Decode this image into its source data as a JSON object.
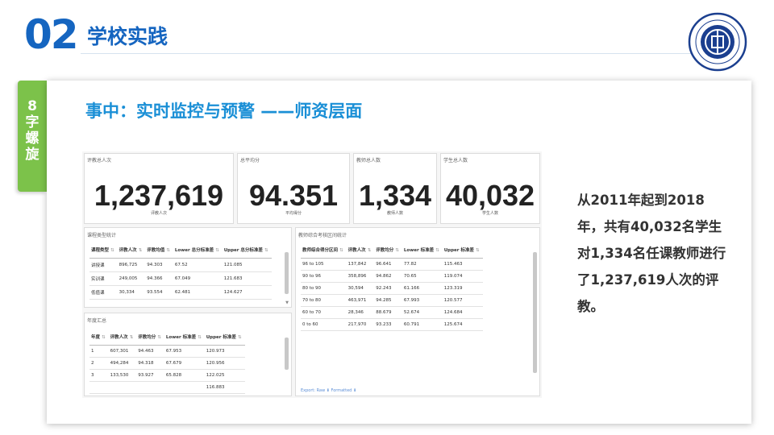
{
  "header": {
    "number": "02",
    "title": "学校实践"
  },
  "side_tag": [
    "8",
    "字",
    "螺",
    "旋"
  ],
  "card": {
    "title": "事中：实时监控与预警 ——师资层面"
  },
  "kpis": [
    {
      "label": "评教总人次",
      "value": "1,237,619",
      "sub": "评教人次"
    },
    {
      "label": "总平均分",
      "value": "94.351",
      "sub": "平均得分"
    },
    {
      "label": "教师总人数",
      "value": "1,334",
      "sub": "教师人数"
    },
    {
      "label": "学生总人数",
      "value": "40,032",
      "sub": "学生人数"
    }
  ],
  "course_table": {
    "title": "课程类型统计",
    "headers": [
      "课程类型",
      "评教人次",
      "评教均值",
      "Lower 总分标准差",
      "Upper 总分标准差"
    ],
    "rows": [
      [
        "讲授课",
        "896,725",
        "94.303",
        "67.52",
        "121.085"
      ],
      [
        "实训课",
        "249,005",
        "94.366",
        "67.049",
        "121.683"
      ],
      [
        "低值课",
        "30,334",
        "93.554",
        "62.481",
        "124.627"
      ]
    ]
  },
  "year_table": {
    "title": "年度汇总",
    "headers": [
      "年度",
      "评教人次",
      "评教均分",
      "Lower 标准差",
      "Upper 标准差"
    ],
    "rows": [
      [
        "1",
        "607,301",
        "94.463",
        "67.953",
        "120.973"
      ],
      [
        "2",
        "494,284",
        "94.318",
        "67.679",
        "120.956"
      ],
      [
        "3",
        "133,530",
        "93.927",
        "65.828",
        "122.025"
      ],
      [
        "",
        "",
        "",
        "",
        "116.883"
      ]
    ]
  },
  "score_table": {
    "title": "教师综合考核区间统计",
    "headers": [
      "教师综合得分区间",
      "评教人次",
      "评教均分",
      "Lower 标准差",
      "Upper 标准差"
    ],
    "rows": [
      [
        "96 to 105",
        "137,842",
        "96.641",
        "77.82",
        "115.463"
      ],
      [
        "90 to 96",
        "358,896",
        "94.862",
        "70.65",
        "119.074"
      ],
      [
        "80 to 90",
        "30,594",
        "92.243",
        "61.166",
        "123.319"
      ],
      [
        "70 to 80",
        "463,971",
        "94.285",
        "67.993",
        "120.577"
      ],
      [
        "60 to 70",
        "28,346",
        "88.679",
        "52.674",
        "124.684"
      ],
      [
        "0 to 60",
        "217,970",
        "93.233",
        "60.791",
        "125.674"
      ]
    ],
    "export": "Export: Raw ⬇   Formatted ⬇"
  },
  "summary": "从2011年起到2018年，共有40,032名学生对1,334名任课教师进行了1,237,619人次的评教。",
  "colors": {
    "brand_blue": "#1565c0",
    "accent_blue": "#1a8fd6",
    "tag_green": "#7cc24a"
  }
}
